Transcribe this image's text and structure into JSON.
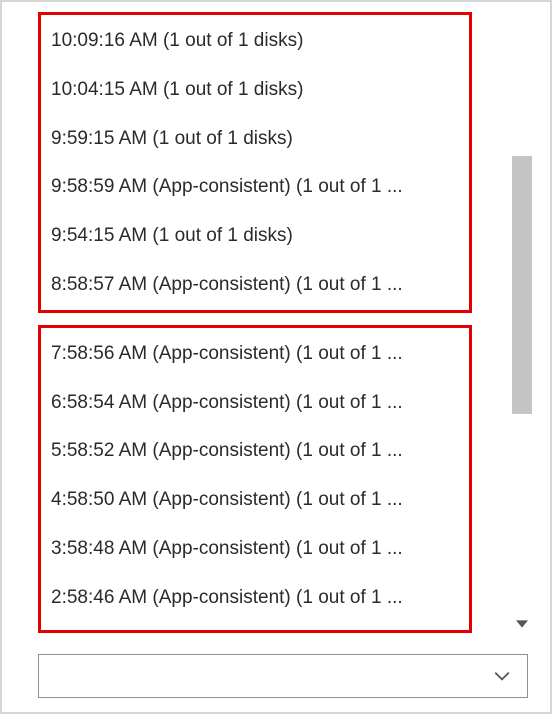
{
  "groupA": {
    "items": [
      {
        "label": "10:09:16 AM (1 out of 1 disks)"
      },
      {
        "label": "10:04:15 AM (1 out of 1 disks)"
      },
      {
        "label": "9:59:15 AM (1 out of 1 disks)"
      },
      {
        "label": "9:58:59 AM (App-consistent) (1 out of 1 ..."
      },
      {
        "label": "9:54:15 AM (1 out of 1 disks)"
      },
      {
        "label": "8:58:57 AM (App-consistent) (1 out of 1 ..."
      }
    ]
  },
  "groupB": {
    "items": [
      {
        "label": "7:58:56 AM (App-consistent) (1 out of 1 ..."
      },
      {
        "label": "6:58:54 AM (App-consistent) (1 out of 1 ..."
      },
      {
        "label": "5:58:52 AM (App-consistent) (1 out of 1 ..."
      },
      {
        "label": "4:58:50 AM (App-consistent) (1 out of 1 ..."
      },
      {
        "label": "3:58:48 AM (App-consistent) (1 out of 1 ..."
      },
      {
        "label": "2:58:46 AM (App-consistent) (1 out of 1 ..."
      }
    ]
  },
  "dropdown": {
    "selected": ""
  },
  "colors": {
    "highlight": "#e40000",
    "scrollbar": "#c5c5c5",
    "border": "#d6d6d6",
    "text": "#2a2a2a"
  }
}
